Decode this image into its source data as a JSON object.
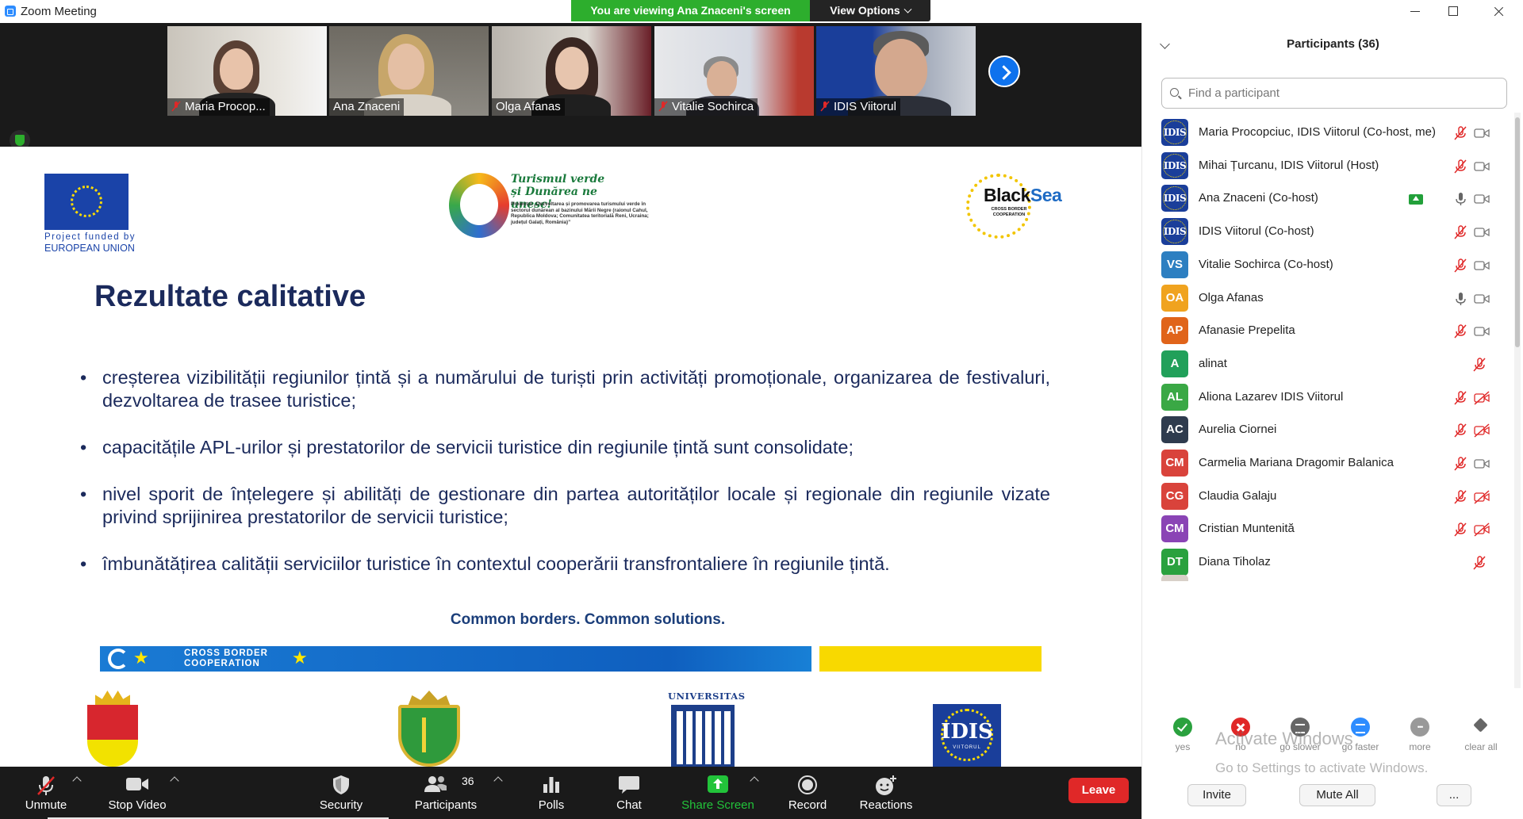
{
  "window": {
    "title": "Zoom Meeting",
    "viewing_banner": "You are viewing Ana Znaceni's screen",
    "view_options": "View Options"
  },
  "video_strip": {
    "participants": [
      {
        "name": "Maria Procop...",
        "muted": true
      },
      {
        "name": "Ana Znaceni",
        "muted": false
      },
      {
        "name": "Olga Afanas",
        "muted": false
      },
      {
        "name": "Vitalie Sochirca",
        "muted": true
      },
      {
        "name": "IDIS Viitorul",
        "muted": true
      }
    ]
  },
  "slide": {
    "eu_caption_line1": "Project funded by",
    "eu_caption_line2": "EUROPEAN UNION",
    "tourism_logo_title": "Turismul verde și Dunărea ne unesc!",
    "tourism_logo_text": "Proiectul „Dezvoltarea și promovarea turismului verde în sectorul dunărean al bazinului Mării Negre (raionul Cahul, Republica Moldova; Comunitatea teritorială Reni, Ucraina; județul Galați, România)”",
    "blacksea_word1": "Black",
    "blacksea_word2": "Sea",
    "blacksea_sub": "CROSS BORDER COOPERATION",
    "title": "Rezultate calitative",
    "bullets": [
      "creșterea vizibilității regiunilor țintă și a numărului de turiști prin activități promoționale, organizarea de festivaluri, dezvoltarea de trasee turistice;",
      "capacitățile APL-urilor și prestatorilor de servicii turistice din regiunile țintă sunt consolidate;",
      "nivel sporit de înțelegere și abilități de gestionare din partea autorităților locale și regionale din regiunile vizate privind sprijinirea prestatorilor de servicii turistice;",
      "îmbunătățirea calității serviciilor turistice în contextul cooperării transfrontaliere în regiunile țintă."
    ],
    "footer_slogan": "Common borders. Common solutions.",
    "cbc_label_line1": "CROSS BORDER",
    "cbc_label_line2": "COOPERATION",
    "university_word": "UNIVERSITAS",
    "idis_word": "IDIS",
    "idis_sub": "VIITORUL"
  },
  "toolbar": {
    "unmute": "Unmute",
    "stop_video": "Stop Video",
    "security": "Security",
    "participants": "Participants",
    "participants_count": "36",
    "polls": "Polls",
    "chat": "Chat",
    "share_screen": "Share Screen",
    "record": "Record",
    "reactions": "Reactions",
    "leave": "Leave",
    "share_color": "#22c33a",
    "leave_color": "#e02828"
  },
  "panel": {
    "title": "Participants (36)",
    "search_placeholder": "Find a participant",
    "participants": [
      {
        "initials": "IDIS",
        "name": "Maria Procopciuc, IDIS Viitorul (Co-host, me)",
        "color": "#1a3e9a",
        "logo": true,
        "mic": "muted",
        "cam": "on"
      },
      {
        "initials": "IDIS",
        "name": "Mihai Țurcanu, IDIS Viitorul (Host)",
        "color": "#1a3e9a",
        "logo": true,
        "mic": "muted",
        "cam": "on"
      },
      {
        "initials": "IDIS",
        "name": "Ana Znaceni (Co-host)",
        "color": "#1a3e9a",
        "logo": true,
        "mic": "on",
        "cam": "on",
        "sharing": true
      },
      {
        "initials": "IDIS",
        "name": "IDIS Viitorul (Co-host)",
        "color": "#1a3e9a",
        "logo": true,
        "mic": "muted",
        "cam": "on"
      },
      {
        "initials": "VS",
        "name": "Vitalie Sochirca (Co-host)",
        "color": "#2d7fc1",
        "logo": false,
        "mic": "muted",
        "cam": "on"
      },
      {
        "initials": "OA",
        "name": "Olga Afanas",
        "color": "#f0a31f",
        "logo": false,
        "mic": "on",
        "cam": "on"
      },
      {
        "initials": "AP",
        "name": "Afanasie Prepelita",
        "color": "#e0641a",
        "logo": false,
        "mic": "muted",
        "cam": "on"
      },
      {
        "initials": "A",
        "name": "alinat",
        "color": "#21a05a",
        "logo": false,
        "mic": "muted",
        "cam": "none"
      },
      {
        "initials": "AL",
        "name": "Aliona Lazarev IDIS Viitorul",
        "color": "#3aa845",
        "logo": false,
        "mic": "muted",
        "cam": "off"
      },
      {
        "initials": "AC",
        "name": "Aurelia Ciornei",
        "color": "#2e3b4e",
        "logo": false,
        "mic": "muted",
        "cam": "off"
      },
      {
        "initials": "CM",
        "name": "Carmelia Mariana Dragomir Balanica",
        "color": "#d9433b",
        "logo": false,
        "mic": "muted",
        "cam": "on"
      },
      {
        "initials": "CG",
        "name": "Claudia Galaju",
        "color": "#d9433b",
        "logo": false,
        "mic": "muted",
        "cam": "off"
      },
      {
        "initials": "CM",
        "name": "Cristian Muntenită",
        "color": "#8a44b5",
        "logo": false,
        "mic": "muted",
        "cam": "off"
      },
      {
        "initials": "DT",
        "name": "Diana Tiholaz",
        "color": "#2aa13e",
        "logo": false,
        "mic": "muted",
        "cam": "none"
      }
    ],
    "feedback": [
      {
        "key": "yes",
        "label": "yes"
      },
      {
        "key": "no",
        "label": "no"
      },
      {
        "key": "slow",
        "label": "go slower"
      },
      {
        "key": "fast",
        "label": "go faster"
      },
      {
        "key": "more",
        "label": "more"
      },
      {
        "key": "clear",
        "label": "clear all"
      }
    ],
    "watermark_line1": "Activate Windows",
    "watermark_line2": "Go to Settings to activate Windows.",
    "invite": "Invite",
    "mute_all": "Mute All",
    "more": "..."
  }
}
